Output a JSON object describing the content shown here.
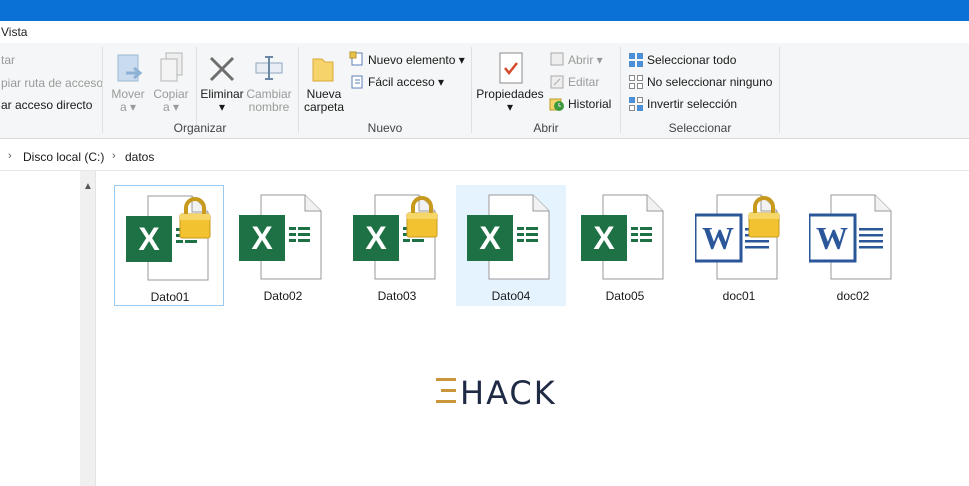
{
  "menubar": {
    "vista": "Vista"
  },
  "ribbon": {
    "clipboard": {
      "anclar": "tar",
      "copiar_ruta": "piar ruta de acceso",
      "pegar_acceso": "ar acceso directo"
    },
    "organizar": {
      "label": "Organizar",
      "mover_line1": "Mover",
      "mover_line2": "a",
      "copiar_line1": "Copiar",
      "copiar_line2": "a",
      "eliminar": "Eliminar",
      "cambiar_line1": "Cambiar",
      "cambiar_line2": "nombre"
    },
    "nuevo": {
      "label": "Nuevo",
      "carpeta_line1": "Nueva",
      "carpeta_line2": "carpeta",
      "nuevo_elemento": "Nuevo elemento",
      "facil_acceso": "Fácil acceso"
    },
    "abrir": {
      "label": "Abrir",
      "propiedades": "Propiedades",
      "abrir": "Abrir",
      "editar": "Editar",
      "historial": "Historial"
    },
    "seleccionar": {
      "label": "Seleccionar",
      "todo": "Seleccionar todo",
      "ninguno": "No seleccionar ninguno",
      "invertir": "Invertir selección"
    }
  },
  "address": {
    "disk": "Disco local (C:)",
    "folder": "datos"
  },
  "files": [
    {
      "name": "Dato01",
      "type": "excel",
      "locked": true
    },
    {
      "name": "Dato02",
      "type": "excel",
      "locked": false
    },
    {
      "name": "Dato03",
      "type": "excel",
      "locked": true
    },
    {
      "name": "Dato04",
      "type": "excel",
      "locked": false
    },
    {
      "name": "Dato05",
      "type": "excel",
      "locked": false
    },
    {
      "name": "doc01",
      "type": "word",
      "locked": true
    },
    {
      "name": "doc02",
      "type": "word",
      "locked": false
    }
  ],
  "watermark": {
    "text": "HACK"
  },
  "colors": {
    "titlebar": "#0a72d6",
    "excel": "#1e7145",
    "word": "#2b579a",
    "selection": "#e5f3ff"
  }
}
